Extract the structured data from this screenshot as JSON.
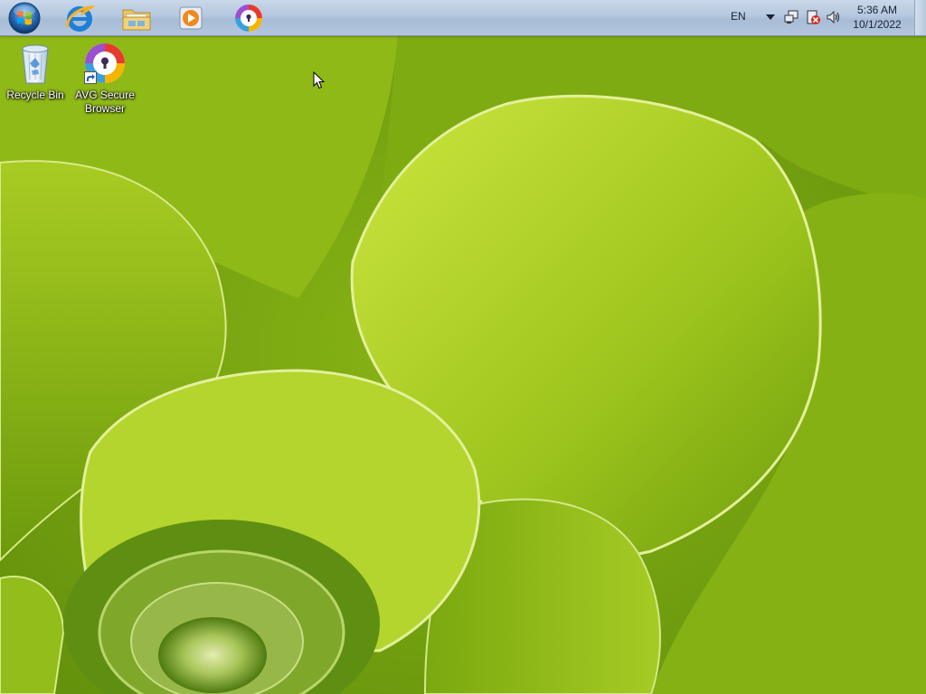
{
  "taskbar": {
    "start_icon": "windows-orb-icon",
    "pinned": [
      {
        "name": "internet-explorer",
        "icon": "internet-explorer-icon"
      },
      {
        "name": "windows-explorer",
        "icon": "folder-icon"
      },
      {
        "name": "windows-media-player",
        "icon": "media-player-icon"
      },
      {
        "name": "avg-secure-browser",
        "icon": "avg-browser-icon"
      }
    ],
    "tray": {
      "language": "EN",
      "time": "5:36 AM",
      "date": "10/1/2022",
      "icons": [
        "show-hidden-icons-arrow",
        "network-icon",
        "action-center-icon",
        "volume-icon"
      ]
    },
    "colors": {
      "bar_top": "#c9d8ea",
      "bar_bottom": "#a7bcd6"
    }
  },
  "desktop": {
    "icons": [
      {
        "label": "Recycle Bin",
        "icon": "recycle-bin-icon"
      },
      {
        "label": "AVG Secure Browser",
        "label_line1": "AVG Secure",
        "label_line2": "Browser",
        "icon": "avg-browser-icon",
        "shortcut": true
      }
    ],
    "wallpaper": "green succulent leaves",
    "colors": {
      "leaf_light": "#c5e03a",
      "leaf_mid": "#8fbb14",
      "leaf_dark": "#4f7a08"
    }
  }
}
